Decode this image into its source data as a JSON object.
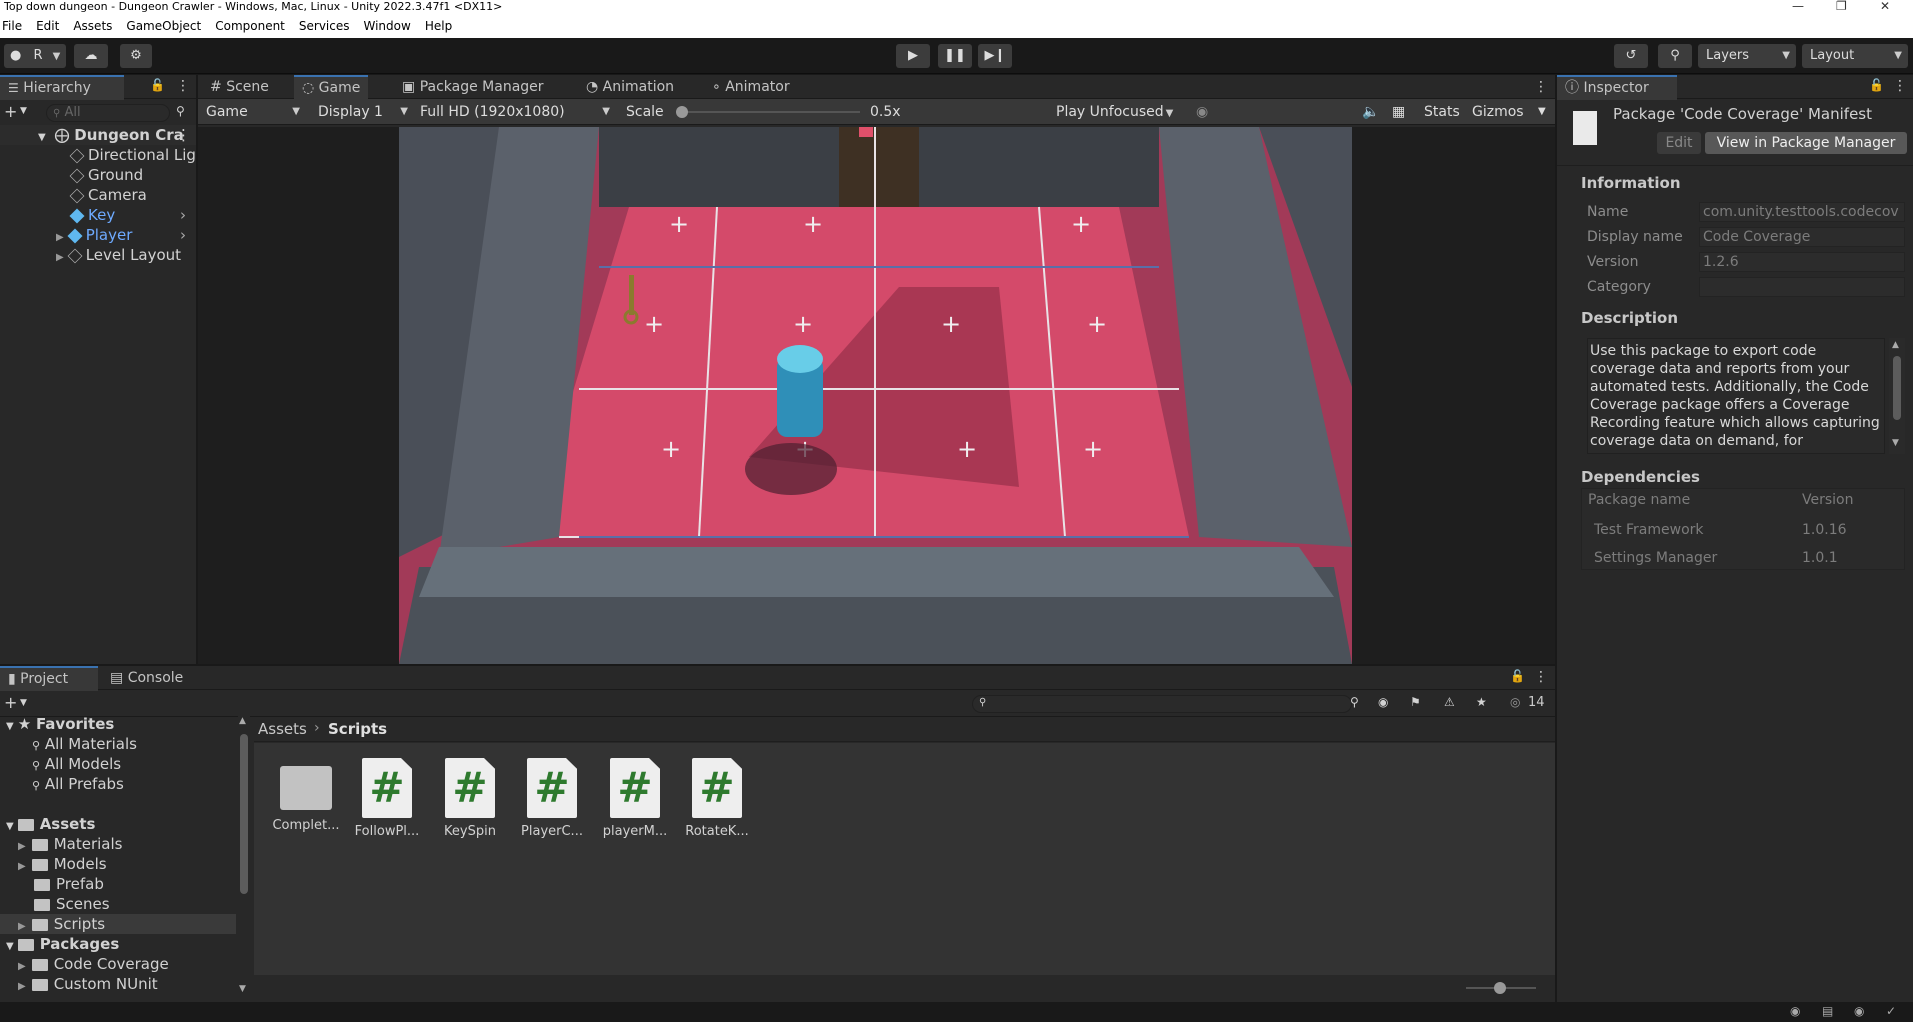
{
  "window": {
    "title": "Top down dungeon - Dungeon Crawler - Windows, Mac, Linux - Unity 2022.3.47f1 <DX11>"
  },
  "menu": [
    "File",
    "Edit",
    "Assets",
    "GameObject",
    "Component",
    "Services",
    "Window",
    "Help"
  ],
  "toolbar": {
    "account_label": "R",
    "layers_label": "Layers",
    "layout_label": "Layout"
  },
  "hierarchy": {
    "tab": "Hierarchy",
    "search_placeholder": "All",
    "scene": "Dungeon Cra",
    "items": [
      "Directional Lig",
      "Ground",
      "Camera",
      "Key",
      "Player",
      "Level Layout"
    ]
  },
  "viewport_tabs": [
    "Scene",
    "Game",
    "Package Manager",
    "Animation",
    "Animator"
  ],
  "game_bar": {
    "mode": "Game",
    "display": "Display 1",
    "resolution": "Full HD (1920x1080)",
    "scale_label": "Scale",
    "scale_value": "0.5x",
    "scale_level": 0.0,
    "play_mode": "Play Unfocused",
    "stats": "Stats",
    "gizmos": "Gizmos"
  },
  "inspector": {
    "tab": "Inspector",
    "title": "Package 'Code Coverage' Manifest",
    "edit_button": "Edit",
    "view_button": "View in Package Manager",
    "information_header": "Information",
    "fields": [
      {
        "label": "Name",
        "value": "com.unity.testtools.codecov"
      },
      {
        "label": "Display name",
        "value": "Code Coverage"
      },
      {
        "label": "Version",
        "value": "1.2.6"
      },
      {
        "label": "Category",
        "value": ""
      }
    ],
    "description_header": "Description",
    "description": "Use this package to export code coverage data and reports from your automated tests. Additionally, the Code Coverage package offers a Coverage Recording feature which allows capturing coverage data on demand, for",
    "dependencies_header": "Dependencies",
    "dep_columns": [
      "Package name",
      "Version"
    ],
    "dependencies": [
      {
        "name": "Test Framework",
        "version": "1.0.16"
      },
      {
        "name": "Settings Manager",
        "version": "1.0.1"
      }
    ]
  },
  "project": {
    "tabs": [
      "Project",
      "Console"
    ],
    "hidden_count": "14",
    "favorites_header": "Favorites",
    "favorites": [
      "All Materials",
      "All Models",
      "All Prefabs"
    ],
    "assets_header": "Assets",
    "asset_folders": [
      "Materials",
      "Models",
      "Prefab",
      "Scenes",
      "Scripts"
    ],
    "packages_header": "Packages",
    "package_folders": [
      "Code Coverage",
      "Custom NUnit"
    ],
    "breadcrumb": [
      "Assets",
      "Scripts"
    ],
    "files": [
      {
        "name": "Complet...",
        "kind": "folder"
      },
      {
        "name": "FollowPl...",
        "kind": "script"
      },
      {
        "name": "KeySpin",
        "kind": "script"
      },
      {
        "name": "PlayerC...",
        "kind": "script"
      },
      {
        "name": "playerM...",
        "kind": "script"
      },
      {
        "name": "RotateK...",
        "kind": "script"
      }
    ]
  }
}
